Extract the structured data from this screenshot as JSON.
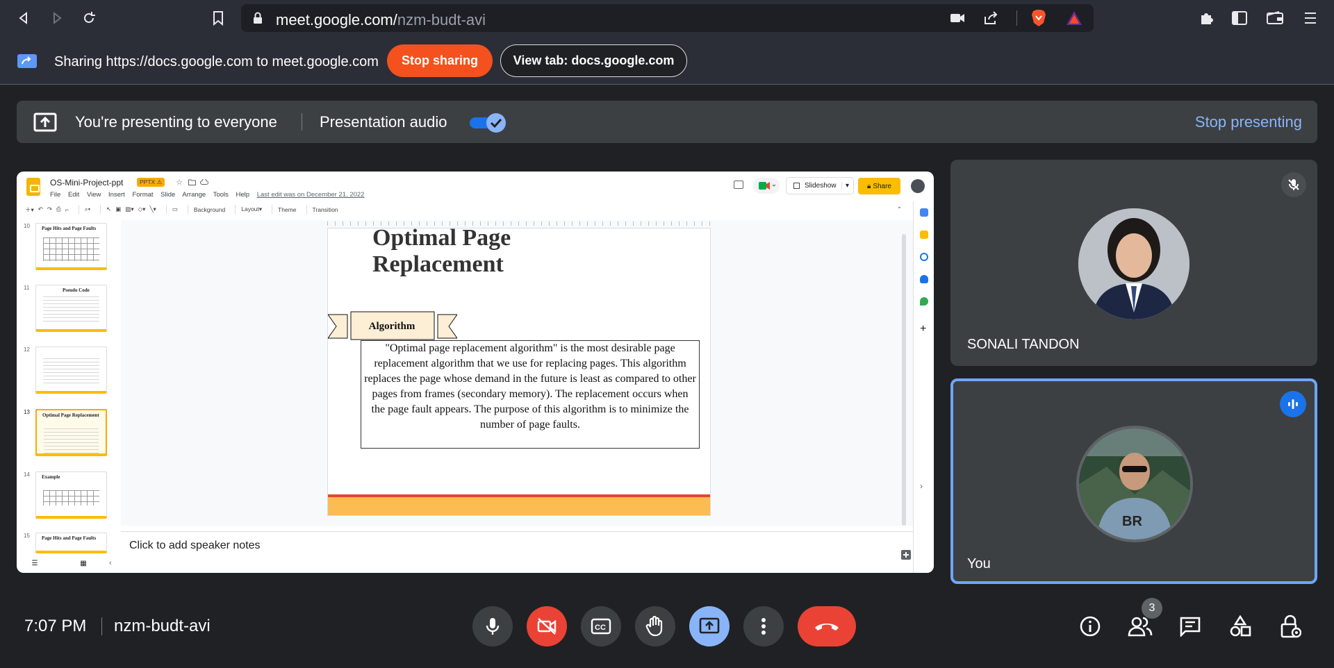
{
  "browser": {
    "url_host": "meet.google.com/",
    "url_path": "nzm-budt-avi"
  },
  "share_banner": {
    "text": "Sharing https://docs.google.com to meet.google.com",
    "stop_sharing": "Stop sharing",
    "view_tab": "View tab: docs.google.com"
  },
  "present_bar": {
    "message": "You're presenting to everyone",
    "audio_label": "Presentation audio",
    "audio_enabled": true,
    "stop_presenting": "Stop presenting"
  },
  "slides_app": {
    "doc_title": "OS-Mini-Project-ppt",
    "badge": "PPTX",
    "menu": [
      "File",
      "Edit",
      "View",
      "Insert",
      "Format",
      "Slide",
      "Arrange",
      "Tools",
      "Help"
    ],
    "last_edit": "Last edit was on December 21, 2022",
    "slideshow": "Slideshow",
    "share": "Share",
    "toolbar": {
      "background": "Background",
      "layout": "Layout",
      "theme": "Theme",
      "transition": "Transition"
    },
    "thumbnails": [
      {
        "num": "10",
        "title": "Page Hits and Page Faults",
        "kind": "grid"
      },
      {
        "num": "11",
        "title": "Pseudo Code",
        "kind": "lines"
      },
      {
        "num": "12",
        "title": "",
        "kind": "lines"
      },
      {
        "num": "13",
        "title": "Optimal Page Replacement",
        "kind": "lines",
        "active": true
      },
      {
        "num": "14",
        "title": "Example",
        "kind": "grid"
      },
      {
        "num": "15",
        "title": "Page Hits and Page Faults",
        "kind": "grid"
      }
    ],
    "slide": {
      "title_line1": "Optimal Page",
      "title_line2": "Replacement",
      "banner": "Algorithm",
      "body": "\"Optimal page replacement algorithm\" is the most desirable page replacement algorithm that we use for replacing pages. This algorithm replaces the page whose demand in the future is least as compared to other pages from frames (secondary memory). The replacement occurs when the page fault appears. The purpose of this algorithm is to minimize the number of page faults."
    },
    "speaker_notes": "Click to add speaker notes"
  },
  "participants": [
    {
      "name": "SONALI TANDON",
      "muted": true
    },
    {
      "name": "You",
      "speaking": true
    }
  ],
  "bottom_bar": {
    "time": "7:07 PM",
    "meeting_code": "nzm-budt-avi",
    "people_count": "3"
  },
  "colors": {
    "accent_blue": "#8ab4f8",
    "stop_red": "#f4511e",
    "danger_red": "#ea4335",
    "active_border": "#6da7f7"
  }
}
